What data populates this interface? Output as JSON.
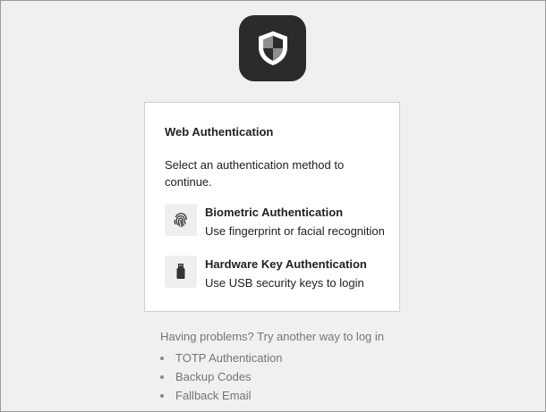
{
  "logo": {
    "icon": "shield-icon",
    "background": "#2b2b2b"
  },
  "card": {
    "title": "Web Authentication",
    "instruction": "Select an authentication method to continue.",
    "methods": [
      {
        "icon": "fingerprint-icon",
        "title": "Biometric Authentication",
        "description": "Use fingerprint or facial recognition"
      },
      {
        "icon": "usb-key-icon",
        "title": "Hardware Key Authentication",
        "description": "Use USB security keys to login"
      }
    ]
  },
  "alternatives": {
    "heading": "Having problems? Try another way to log in",
    "items": [
      "TOTP Authentication",
      "Backup Codes",
      "Fallback Email"
    ]
  },
  "colors": {
    "page_background": "#f0f0f0",
    "card_background": "#ffffff",
    "muted_text": "#757575"
  }
}
